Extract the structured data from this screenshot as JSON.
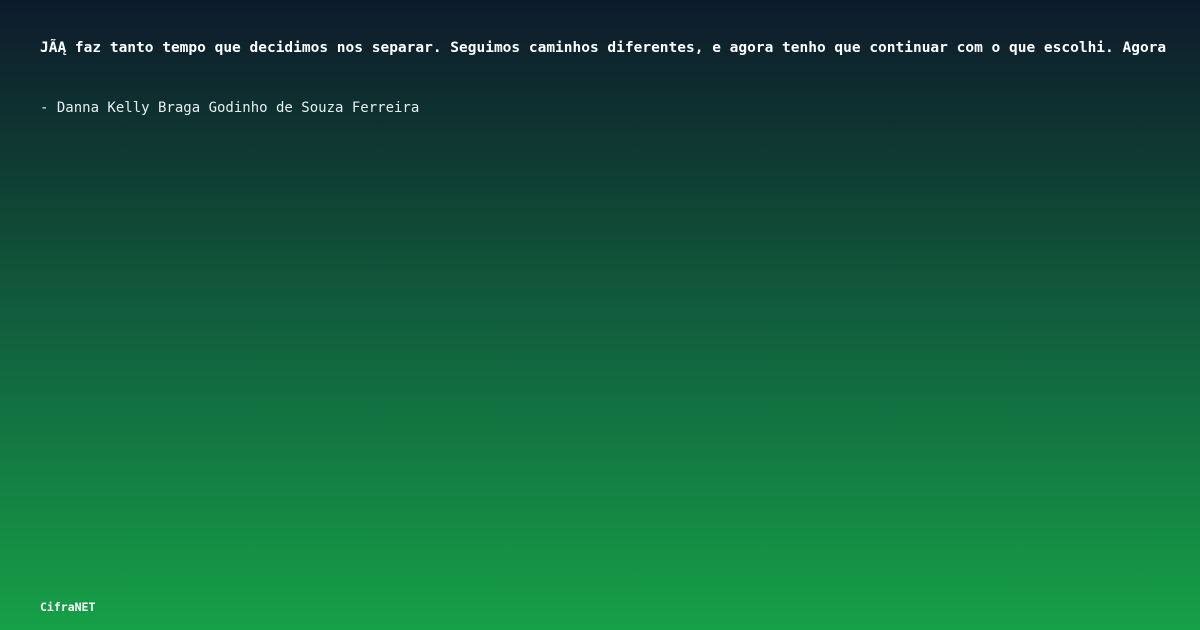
{
  "quote": {
    "text": "JÃĄ faz tanto tempo que decidimos nos separar. Seguimos caminhos diferentes, e agora tenho que continuar com o que escolhi. Agora"
  },
  "author": {
    "text": "- Danna Kelly Braga Godinho de Souza Ferreira"
  },
  "brand": {
    "name": "CifraNET"
  },
  "colors": {
    "gradient_top": "#0d1a2b",
    "gradient_bottom": "#16a047",
    "text": "#ffffff"
  }
}
